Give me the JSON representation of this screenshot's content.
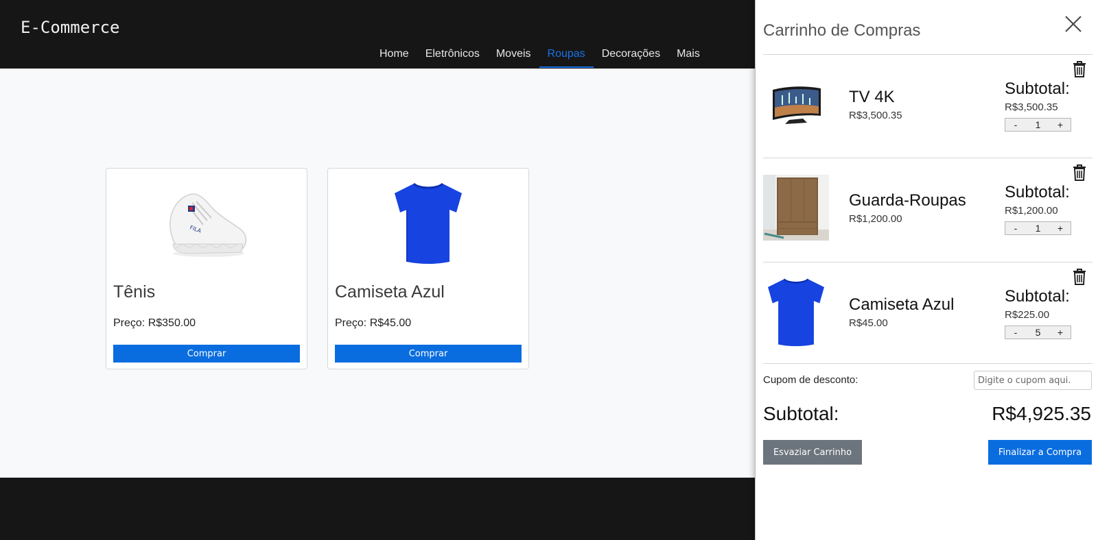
{
  "header": {
    "brand": "E-Commerce",
    "nav": [
      {
        "label": "Home",
        "active": false
      },
      {
        "label": "Eletrônicos",
        "active": false
      },
      {
        "label": "Moveis",
        "active": false
      },
      {
        "label": "Roupas",
        "active": true
      },
      {
        "label": "Decorações",
        "active": false
      },
      {
        "label": "Mais",
        "active": false
      }
    ],
    "accent_color": "#1a73e8"
  },
  "products": [
    {
      "name": "Tênis",
      "price": "Preço: R$350.00",
      "button": "Comprar",
      "icon": "sneaker-image"
    },
    {
      "name": "Camiseta Azul",
      "price": "Preço: R$45.00",
      "button": "Comprar",
      "icon": "blue-tshirt-image"
    }
  ],
  "cart": {
    "title": "Carrinho de Compras",
    "items": [
      {
        "name": "TV 4K",
        "price": "R$3,500.35",
        "subtotal_label": "Subtotal:",
        "subtotal": "R$3,500.35",
        "qty": "1",
        "minus": "-",
        "plus": "+",
        "icon": "tv-image"
      },
      {
        "name": "Guarda-Roupas",
        "price": "R$1,200.00",
        "subtotal_label": "Subtotal:",
        "subtotal": "R$1,200.00",
        "qty": "1",
        "minus": "-",
        "plus": "+",
        "icon": "wardrobe-image"
      },
      {
        "name": "Camiseta Azul",
        "price": "R$45.00",
        "subtotal_label": "Subtotal:",
        "subtotal": "R$225.00",
        "qty": "5",
        "minus": "-",
        "plus": "+",
        "icon": "blue-tshirt-image"
      }
    ],
    "coupon_label": "Cupom de desconto:",
    "coupon_placeholder": "Digite o cupom aqui.",
    "total_label": "Subtotal:",
    "total": "R$4,925.35",
    "empty_button": "Esvaziar Carrinho",
    "checkout_button": "Finalizar a Compra"
  },
  "colors": {
    "primary_button": "#0a6ddf",
    "secondary_button": "#6c757d",
    "header_bg": "#161616"
  }
}
